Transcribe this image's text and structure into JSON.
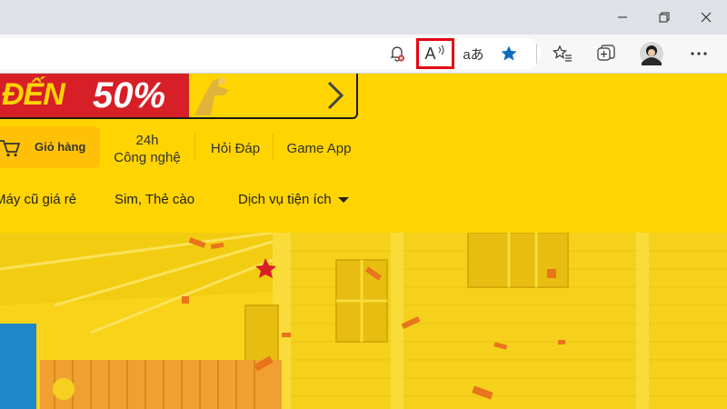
{
  "browser": {
    "icons": {
      "notification": "notification-bell-icon",
      "read_aloud": "read-aloud-icon",
      "translate": "translate-icon",
      "favorite": "favorite-star-icon",
      "favorites_list": "favorites-list-icon",
      "collections": "collections-icon",
      "profile": "profile-avatar",
      "more": "more-menu-icon"
    },
    "read_aloud_label": "A",
    "translate_label": "aあ",
    "highlight_color": "#e30613",
    "favorite_color": "#0f6cbd"
  },
  "banner": {
    "text": "ĐẾN",
    "percent": "50%"
  },
  "nav": {
    "cart_label": "Giỏ hàng",
    "links": [
      {
        "line1": "24h",
        "line2": "Công nghệ"
      },
      {
        "line1": "Hỏi Đáp",
        "line2": ""
      },
      {
        "line1": "Game App",
        "line2": ""
      }
    ]
  },
  "menu": {
    "items": [
      {
        "label": "Máy cũ giá rẻ"
      },
      {
        "label": "Sim, Thẻ cào"
      },
      {
        "label": "Dịch vụ tiện ích"
      }
    ],
    "dropdown_icon": "caret-down-icon"
  },
  "colors": {
    "page_yellow": "#ffd400",
    "banner_red": "#d61f26",
    "cart_button": "#ffc107"
  }
}
